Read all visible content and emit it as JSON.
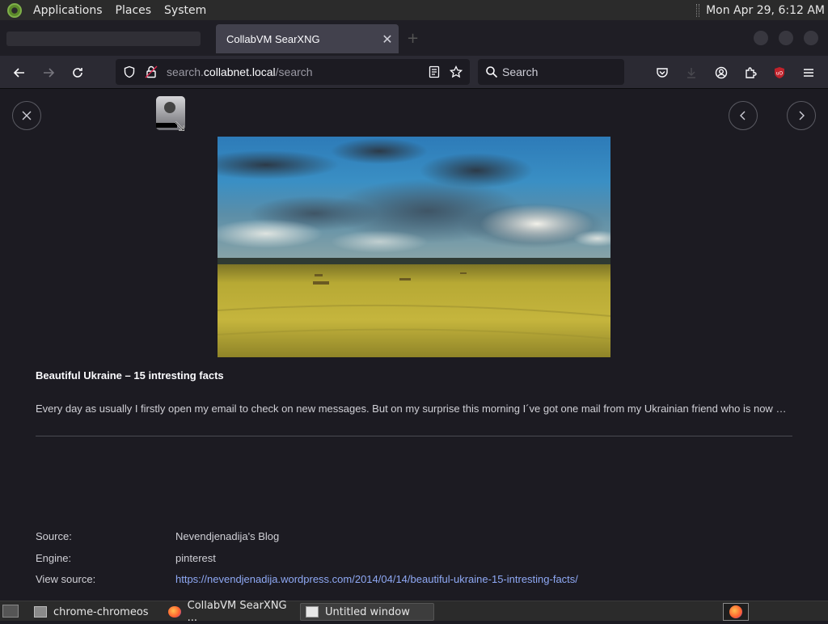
{
  "top_panel": {
    "menus": [
      "Applications",
      "Places",
      "System"
    ],
    "clock": "Mon Apr 29,  6:12 AM"
  },
  "browser": {
    "tab_title": "CollabVM SearXNG",
    "url_prefix": "search.",
    "url_host": "collabnet.local",
    "url_path": "/search",
    "search_placeholder": "Search"
  },
  "result": {
    "title": "Beautiful Ukraine – 15 intresting facts",
    "snippet": "Every day as usually I firstly open my email to check on new messages. But on my surprise this morning I´ve got one mail from my Ukrainian friend who is now working abroad for some time and he sent me this beautiful article",
    "source_label": "Source:",
    "source_value": "Nevendjenadija's Blog",
    "engine_label": "Engine:",
    "engine_value": "pinterest",
    "view_source_label": "View source:",
    "view_source_url": "https://nevendjenadija.wordpress.com/2014/04/14/beautiful-ukraine-15-intresting-facts/"
  },
  "taskbar": {
    "tasks": [
      "chrome-chromeos",
      "CollabVM SearXNG ...",
      "Untitled window"
    ]
  },
  "colors": {
    "page_bg": "#1c1b22",
    "toolbar_bg": "#2b2a33",
    "link": "#8fa9f5",
    "ublock_red": "#c0222b"
  }
}
